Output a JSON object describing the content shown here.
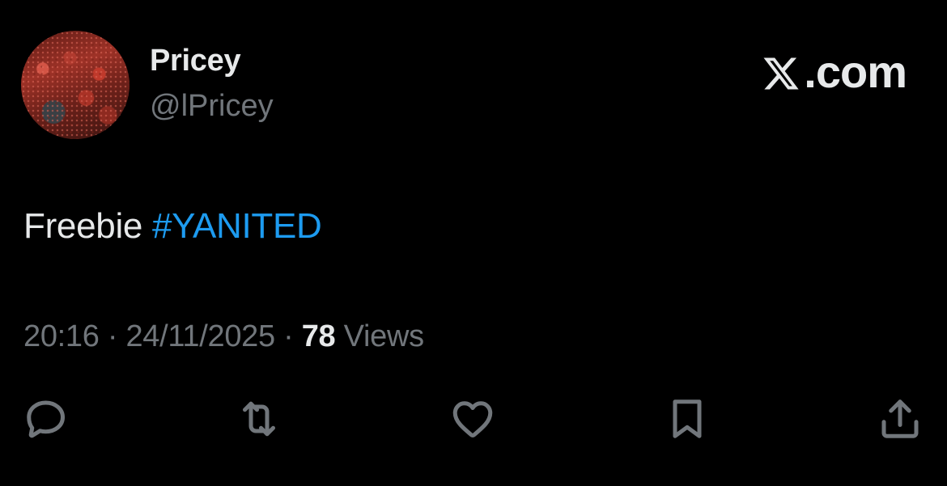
{
  "author": {
    "display_name": "Pricey",
    "handle": "@lPricey"
  },
  "brand": {
    "label": ".com",
    "icon": "x-logo-icon"
  },
  "tweet": {
    "text": "Freebie ",
    "hashtag": "#YANITED"
  },
  "meta": {
    "time": "20:16",
    "separator": " · ",
    "date": "24/11/2025",
    "views_count": "78",
    "views_label": " Views"
  },
  "actions": [
    {
      "name": "reply",
      "icon": "reply-icon"
    },
    {
      "name": "repost",
      "icon": "repost-icon"
    },
    {
      "name": "like",
      "icon": "heart-icon"
    },
    {
      "name": "bookmark",
      "icon": "bookmark-icon"
    },
    {
      "name": "share",
      "icon": "share-icon"
    }
  ],
  "colors": {
    "background": "#000000",
    "primary_text": "#e7e9ea",
    "secondary_text": "#71767b",
    "accent": "#1d9bf0"
  }
}
